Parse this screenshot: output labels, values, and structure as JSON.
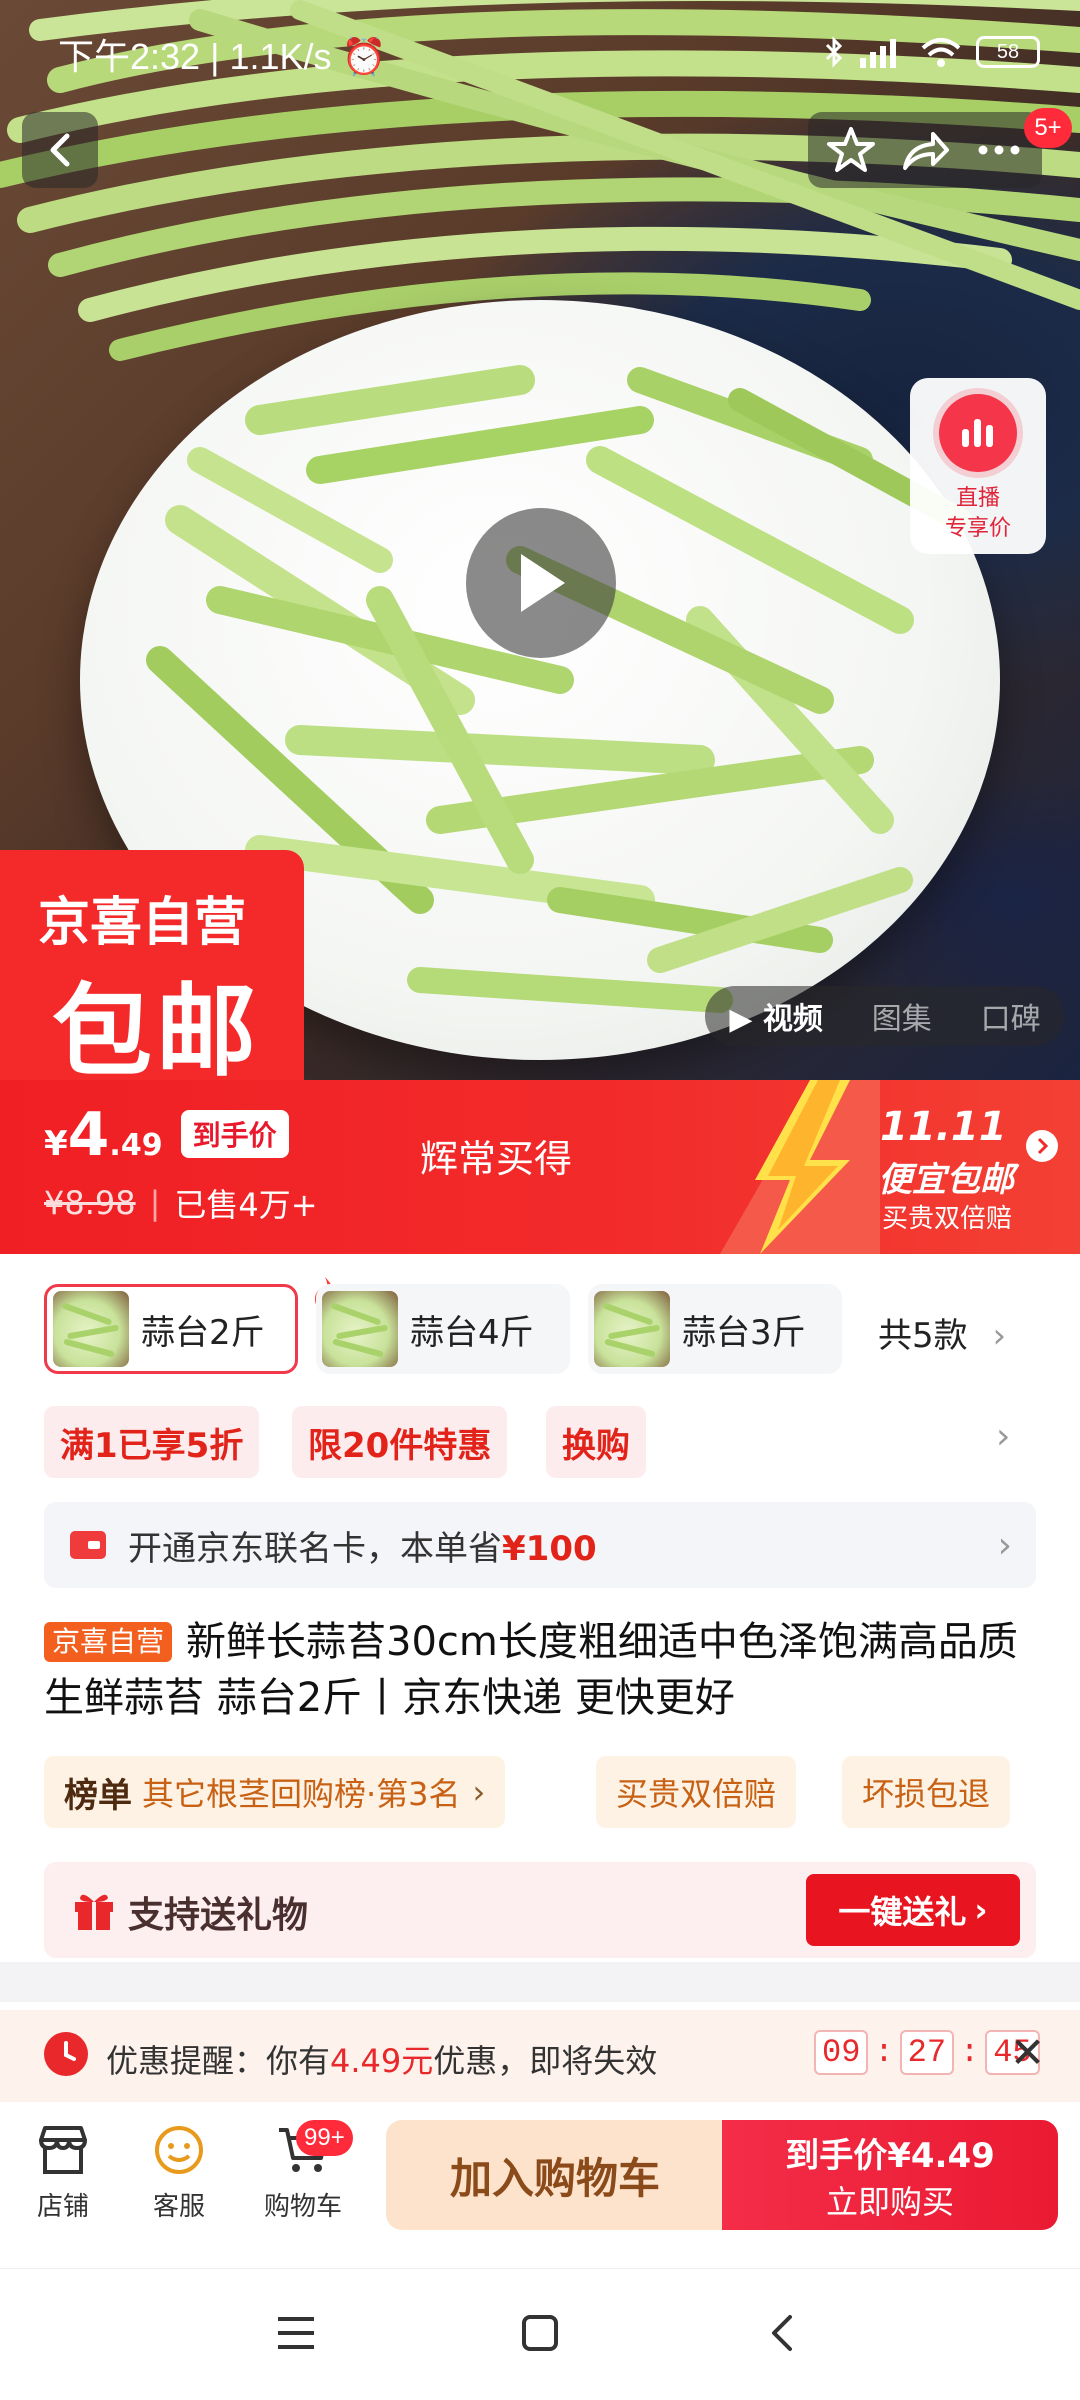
{
  "status_bar": {
    "time": "下午2:32",
    "speed": "1.1K/s",
    "battery": "58"
  },
  "header": {
    "notif_badge": "5+"
  },
  "live": {
    "line1": "直播",
    "line2": "专享价"
  },
  "promo_tag": {
    "line1": "京喜自营",
    "line2": "包邮"
  },
  "media_tabs": [
    "视频",
    "图集",
    "口碑"
  ],
  "price": {
    "currency": "¥",
    "int": "4",
    "dec": ".49",
    "final_tag": "到手价",
    "original": "¥8.98",
    "sold": "已售4万+",
    "slogan": "辉常买得"
  },
  "double11": {
    "title": "11.11",
    "subtitle": "便宜包邮",
    "small": "买贵双倍赔"
  },
  "variants": [
    {
      "label": "蒜台2斤"
    },
    {
      "label": "蒜台4斤"
    },
    {
      "label": "蒜台3斤"
    }
  ],
  "variants_total": "共5款",
  "promo_chips": [
    "满1已享5折",
    "限20件特惠",
    "换购"
  ],
  "member_card": {
    "prefix": "开通京东联名卡，本单省",
    "amount": "¥100"
  },
  "product": {
    "badge": "京喜自营",
    "title": "新鲜长蒜苔30cm长度粗细适中色泽饱满高品质生鲜蒜苔 蒜台2斤丨京东快递 更快更好"
  },
  "rank": {
    "label": "榜单",
    "text": "其它根茎回购榜·第3名"
  },
  "guarantees": [
    "买贵双倍赔",
    "坏损包退"
  ],
  "gift": {
    "text": "支持送礼物",
    "button": "一键送礼"
  },
  "reminder": {
    "prefix": "优惠提醒：你有",
    "amount": "4.49元",
    "suffix": "优惠，即将失效",
    "hh": "09",
    "mm": "27",
    "ss": "45"
  },
  "bottom_nav": {
    "store": "店铺",
    "service": "客服",
    "cart": "购物车",
    "cart_badge": "99+"
  },
  "actions": {
    "add_to_cart": "加入购物车",
    "buy_line1": "到手价¥4.49",
    "buy_line2": "立即购买"
  },
  "colors": {
    "brand_red": "#f22a2a",
    "buy_pink": "#f42d48",
    "add_cart_bg": "#fde2cc"
  }
}
